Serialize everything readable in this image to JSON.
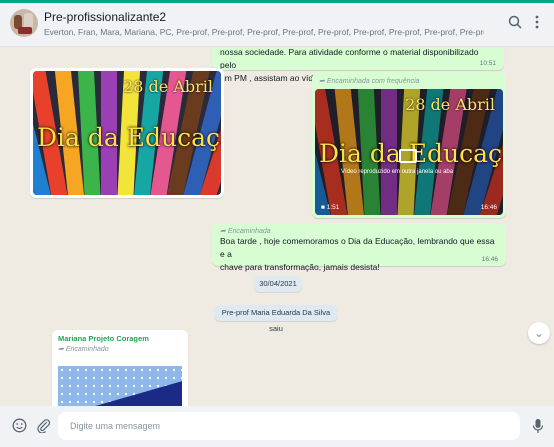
{
  "header": {
    "title": "Pre-profissionalizante2",
    "members": "Everton, Fran, Mara, Mariana, PC, Pre-prof, Pre-prof, Pre-prof, Pre-prof, Pre-prof, Pre-prof, Pre-prof, Pre-prof, Pre-prof, Pre-prof, Pre-prof, Pre-prof, Pre-prof, Pre-prof, Pre-prof, Pre-prof, Pre-prof, Pre-prof, Pre-prof, Pre-prof, Pre-prof, Pre-prof..."
  },
  "messages": {
    "top_partial": {
      "text_line1": "nossa sociedade. Para atividade conforme o material disponibilizado pelo",
      "text_line2": "um PM , assistam ao vídeo com atenção e deixem seu comentário.",
      "time": "10:51"
    },
    "image_in": {
      "date_text": "28 de Abril",
      "title_text": "Dia da Educação"
    },
    "video_out": {
      "forwarded_label": "Encaminhada com frequência",
      "date_text": "28 de Abril",
      "title_text": "Dia da Educação",
      "overlay_caption": "Vídeo reproduzido em outra janela ou aba",
      "duration": "1:51",
      "time": "16:46"
    },
    "text_out": {
      "forwarded_label": "Encaminhada",
      "text_line1": "Boa tarde , hoje comemoramos o Dia da Educação, lembrando que essa e a",
      "text_line2": "chave para transformação, jamais desista!",
      "time": "16:46"
    },
    "date_separator": "30/04/2021",
    "system_notice": "Pre-prof Maria Eduarda Da Silva saiu",
    "last_in": {
      "sender": "Mariana Projeto Coragem",
      "forwarded_label": "Encaminhado"
    }
  },
  "footer": {
    "input_placeholder": "Digite uma mensagem"
  },
  "icons": {
    "search": "search-icon",
    "menu": "menu-dots-icon",
    "emoji": "emoji-icon",
    "attach": "paperclip-icon",
    "mic": "microphone-icon",
    "scroll_down": "chevron-down-icon"
  },
  "colors": {
    "accent": "#00a884",
    "outgoing_bubble": "#d9fdd3",
    "incoming_bubble": "#ffffff",
    "chat_background": "#efeae2",
    "sender_name": "#1fa855"
  }
}
